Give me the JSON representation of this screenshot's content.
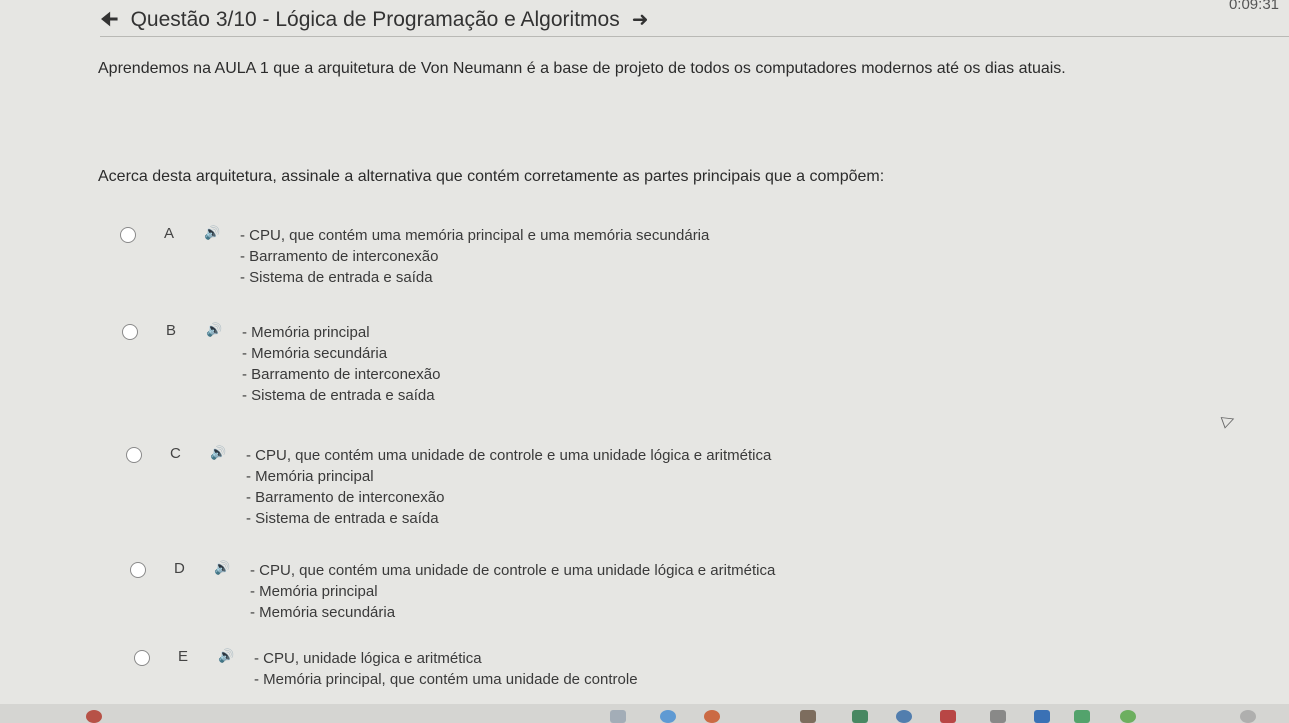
{
  "timer": "0:09:31",
  "header": {
    "back_icon": "arrow-left-icon",
    "title": "Questão 3/10 - Lógica de Programação e Algoritmos",
    "next_icon": "arrow-right-icon"
  },
  "question": {
    "intro": "Aprendemos na AULA 1 que a arquitetura de Von Neumann é a base de projeto de todos os computadores modernos até os dias atuais.",
    "prompt": "Acerca desta arquitetura, assinale a alternativa que contém corretamente as partes principais que a compõem:"
  },
  "options": [
    {
      "letter": "A",
      "lines": [
        "- CPU, que contém uma memória principal e uma memória secundária",
        "- Barramento de interconexão",
        "- Sistema de entrada e saída"
      ]
    },
    {
      "letter": "B",
      "lines": [
        "- Memória principal",
        "- Memória secundária",
        "- Barramento de interconexão",
        "- Sistema de entrada e saída"
      ]
    },
    {
      "letter": "C",
      "lines": [
        "- CPU, que contém uma unidade de controle e uma unidade lógica e aritmética",
        "- Memória principal",
        "- Barramento de interconexão",
        "- Sistema de entrada e saída"
      ]
    },
    {
      "letter": "D",
      "lines": [
        "- CPU, que contém uma unidade de controle e uma unidade lógica e aritmética",
        "- Memória principal",
        "- Memória secundária"
      ]
    },
    {
      "letter": "E",
      "lines": [
        "- CPU, unidade lógica e aritmética",
        "- Memória principal, que contém uma unidade de controle"
      ]
    }
  ],
  "icons": {
    "speaker": "speaker-icon",
    "cursor": "mouse-cursor-icon"
  },
  "colors": {
    "background": "#e6e6e3",
    "text": "#2a2a2a"
  }
}
